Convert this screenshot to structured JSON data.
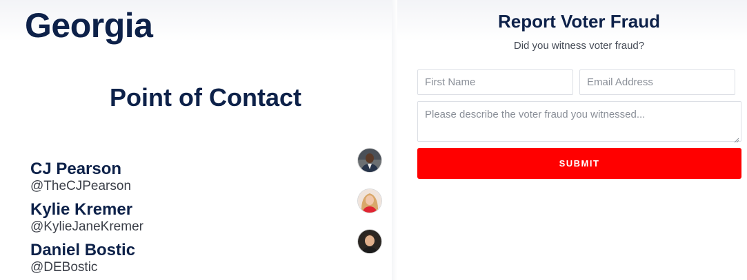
{
  "left": {
    "state": "Georgia",
    "heading": "Point of Contact",
    "contacts": [
      {
        "name": "CJ Pearson",
        "handle": "@TheCJPearson"
      },
      {
        "name": "Kylie Kremer",
        "handle": "@KylieJaneKremer"
      },
      {
        "name": "Daniel Bostic",
        "handle": "@DEBostic"
      }
    ]
  },
  "form": {
    "title": "Report Voter Fraud",
    "subtitle": "Did you witness voter fraud?",
    "first_name_placeholder": "First Name",
    "email_placeholder": "Email Address",
    "description_placeholder": "Please describe the voter fraud you witnessed...",
    "submit_label": "SUBMIT"
  },
  "colors": {
    "heading": "#0d2149",
    "submit": "#ff0000"
  }
}
